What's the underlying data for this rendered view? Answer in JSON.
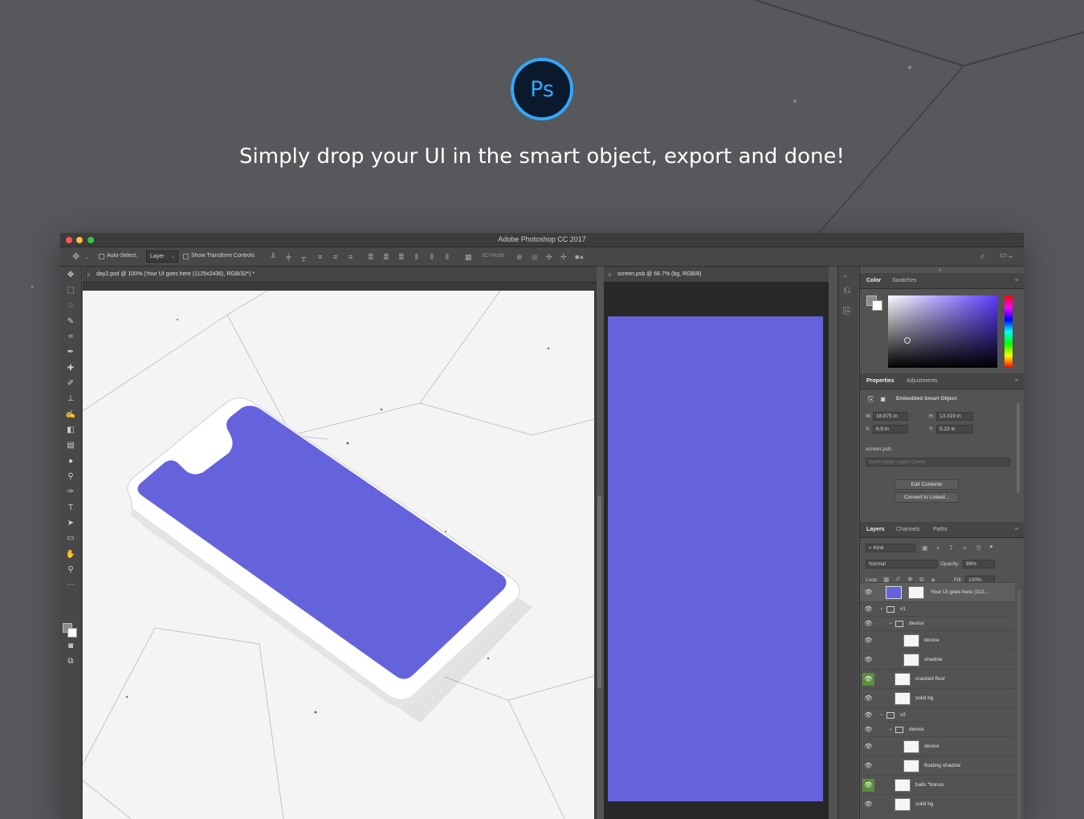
{
  "hero": {
    "logo_text": "Ps",
    "tagline": "Simply drop your UI in the smart object, export and done!"
  },
  "window": {
    "title": "Adobe Photoshop CC 2017"
  },
  "options_bar": {
    "auto_select_label": "Auto-Select:",
    "auto_select_value": "Layer",
    "transform_controls_label": "Show Transform Controls",
    "mode_3d_label": "3D Mode:"
  },
  "documents": [
    {
      "tab_label": "day2.psd @ 100% (Your UI goes here (1125x2436), RGB/32*) *",
      "close": "×"
    },
    {
      "tab_label": "screen.psb @ 66.7% (bg, RGB/8)",
      "close": "×"
    }
  ],
  "color_panel": {
    "tabs": [
      "Color",
      "Swatches"
    ]
  },
  "properties_panel": {
    "tabs": [
      "Properties",
      "Adjustments"
    ],
    "object_type": "Embedded Smart Object",
    "w_label": "W:",
    "w_value": "18.875 in",
    "h_label": "H:",
    "h_value": "13.319 in",
    "x_label": "X:",
    "x_value": "6.9 in",
    "y_label": "Y:",
    "y_value": "5.23 in",
    "file_name": "screen.psb",
    "layer_comp_placeholder": "Don't Apply Layer Comp",
    "edit_contents_label": "Edit Contents",
    "convert_label": "Convert to Linked..."
  },
  "layers_panel": {
    "tabs": [
      "Layers",
      "Channels",
      "Paths"
    ],
    "filter_kind": "Kind",
    "blend_mode": "Normal",
    "opacity_label": "Opacity:",
    "opacity_value": "99%",
    "lock_label": "Lock:",
    "fill_label": "Fill:",
    "fill_value": "100%",
    "layers": [
      {
        "name": "Your UI goes here (112...",
        "type": "smart",
        "indent": 0,
        "visible_highlight": false
      },
      {
        "name": "v1",
        "type": "group",
        "indent": 0,
        "visible_highlight": false
      },
      {
        "name": "device",
        "type": "group",
        "indent": 1,
        "visible_highlight": false
      },
      {
        "name": "device",
        "type": "layer",
        "indent": 2,
        "visible_highlight": false
      },
      {
        "name": "shadow",
        "type": "layer",
        "indent": 2,
        "visible_highlight": false
      },
      {
        "name": "cracked floor",
        "type": "layer",
        "indent": 1,
        "visible_highlight": true
      },
      {
        "name": "solid bg",
        "type": "layer",
        "indent": 1,
        "visible_highlight": false
      },
      {
        "name": "v2",
        "type": "group",
        "indent": 0,
        "visible_highlight": false
      },
      {
        "name": "device",
        "type": "group",
        "indent": 1,
        "visible_highlight": false
      },
      {
        "name": "device",
        "type": "layer",
        "indent": 2,
        "visible_highlight": false
      },
      {
        "name": "floating shadow",
        "type": "layer",
        "indent": 2,
        "visible_highlight": false
      },
      {
        "name": "balls *bonus",
        "type": "layer",
        "indent": 1,
        "visible_highlight": true
      },
      {
        "name": "solid bg",
        "type": "layer",
        "indent": 1,
        "visible_highlight": false
      }
    ]
  },
  "colors": {
    "screen_purple": "#6563dc",
    "ps_blue": "#31a8ff",
    "visibility_green": "#5a8f3c"
  }
}
